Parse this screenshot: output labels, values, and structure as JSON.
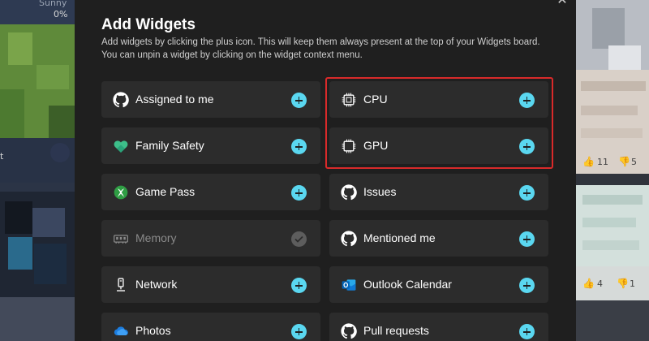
{
  "background": {
    "left_partial_text": "Sunny",
    "left_precip": "0%",
    "left_fragment": "t",
    "right_likes_top": "11",
    "right_dislikes_top": "5",
    "right_likes_bottom": "4",
    "right_dislikes_bottom": "1"
  },
  "dialog": {
    "title": "Add Widgets",
    "subtitle_line1": "Add widgets by clicking the plus icon. This will keep them always present at the top of your Widgets board.",
    "subtitle_line2": "You can unpin a widget by clicking on the widget context menu.",
    "close_icon": "close-icon"
  },
  "widgets": {
    "left": [
      {
        "label": "Assigned to me",
        "icon": "github-icon",
        "state": "add"
      },
      {
        "label": "Family Safety",
        "icon": "family-safety-icon",
        "state": "add"
      },
      {
        "label": "Game Pass",
        "icon": "xbox-icon",
        "state": "add"
      },
      {
        "label": "Memory",
        "icon": "memory-icon",
        "state": "added"
      },
      {
        "label": "Network",
        "icon": "network-icon",
        "state": "add"
      },
      {
        "label": "Photos",
        "icon": "onedrive-icon",
        "state": "add"
      }
    ],
    "right": [
      {
        "label": "CPU",
        "icon": "chip-icon",
        "state": "add"
      },
      {
        "label": "GPU",
        "icon": "chip-icon",
        "state": "add"
      },
      {
        "label": "Issues",
        "icon": "github-icon",
        "state": "add"
      },
      {
        "label": "Mentioned me",
        "icon": "github-icon",
        "state": "add"
      },
      {
        "label": "Outlook Calendar",
        "icon": "outlook-icon",
        "state": "add"
      },
      {
        "label": "Pull requests",
        "icon": "github-icon",
        "state": "add"
      }
    ]
  },
  "colors": {
    "accent": "#5ad7f0",
    "highlight": "#d92a2a",
    "dialog_bg": "#1f1f1f",
    "tile_bg": "#2c2c2c"
  }
}
